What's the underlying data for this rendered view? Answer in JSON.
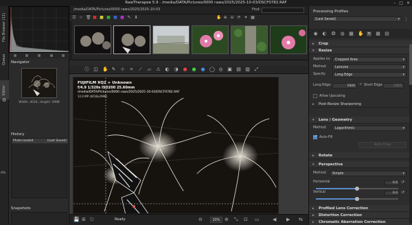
{
  "window": {
    "title": "RawTherapee 5.9 - /media/DATA/Pictures/0000 raws/2025/2025-10-03/DSCF0782.RAF",
    "controls": [
      "–",
      "□",
      "✕"
    ]
  },
  "side_tabs": {
    "file_browser": "File Browser (11)",
    "queue": "Queue",
    "editor": "Editor",
    "percent": "0%"
  },
  "left": {
    "navigator_title": "Navigator",
    "nav_info": "Width: 4016, Height: 2998",
    "history_title": "History",
    "history_items": [
      {
        "label": "Photo loaded",
        "value": "(Last Saved)"
      }
    ],
    "snapshots_title": "Snapshots",
    "snapshot_tools": [
      "+",
      "–"
    ]
  },
  "browser": {
    "path": "/media/DATA/Pictures/0000 raws/2025/2025-10-03",
    "find_label": "Find:",
    "find_value": ""
  },
  "preview": {
    "exif_line1": "FUJIFILM XQ2 + Unknown",
    "exif_line2": "f/4.9  1/320s  ISO200  25.60mm",
    "exif_line3": "/media/DATA/Pictures/0000 raws/2025/2025-10-03/DSCF0782.RAF",
    "exif_line4": "12.0 MP (4016x2998)"
  },
  "status": {
    "ready": "Ready",
    "zoom": "20%"
  },
  "right": {
    "panel_title": "Processing Profiles",
    "profile_value": "(Last Saved)",
    "sections": {
      "crop": "Crop",
      "resize": "Resize",
      "lens": "Lens / Geometry",
      "rotate": "Rotate",
      "perspective": "Perspective",
      "profiled_lens": "Profiled Lens Correction",
      "distortion": "Distortion Correction",
      "chromatic": "Chromatic Aberration Correction"
    },
    "resize": {
      "applies_to_label": "Applies to:",
      "applies_to_value": "Cropped Area",
      "method_label": "Method:",
      "method_value": "Lanczos",
      "specify_label": "Specify:",
      "specify_value": "Long Edge",
      "long_edge_label": "Long Edge:",
      "long_edge_value": "1920",
      "short_edge_label": "Short Edge:",
      "short_edge_value": "1415",
      "upscaling_label": "Allow Upscaling",
      "sharpening_label": "Post-Resize Sharpening"
    },
    "lens": {
      "method_label": "Method:",
      "method_value": "Logarithmic",
      "autofill_label": "Auto-Fill",
      "autocrop_label": "Auto Crop"
    },
    "perspective": {
      "method_label": "Method:",
      "method_value": "Simple",
      "horizontal_label": "Horizontal",
      "horizontal_value": "0.0",
      "horizontal_level": 0.5,
      "vertical_label": "Vertical",
      "vertical_value": "0.0",
      "vertical_level": 0.5
    }
  }
}
